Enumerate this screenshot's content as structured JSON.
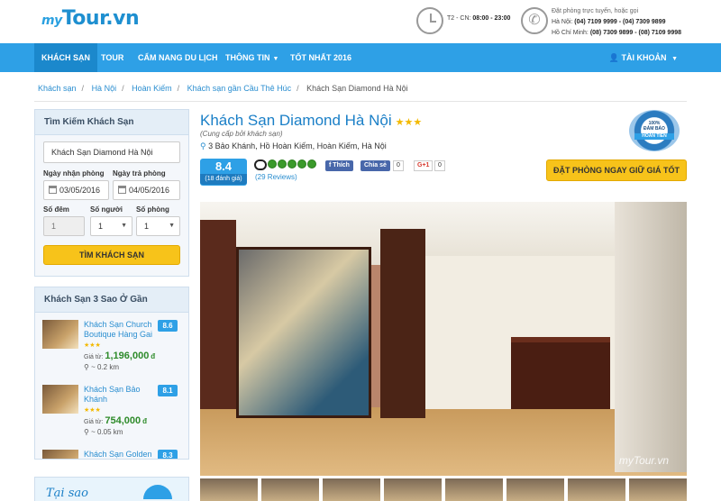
{
  "header": {
    "logo_prefix": "my",
    "logo_main": "Tour.vn",
    "hours_label": "T2 - CN:",
    "hours_value": "08:00 - 23:00",
    "contact_title": "Đặt phòng trực tuyến, hoặc gọi",
    "contact_hn_label": "Hà Nội:",
    "contact_hn_value": "(04) 7109 9999 - (04) 7309 9899",
    "contact_hcm_label": "Hồ Chí Minh:",
    "contact_hcm_value": "(08) 7309 9899 - (08) 7109 9998"
  },
  "nav": {
    "items": [
      "KHÁCH SẠN",
      "TOUR",
      "CẨM NANG DU LỊCH",
      "THÔNG TIN",
      "TỐT NHẤT 2016"
    ],
    "account": "TÀI KHOẢN"
  },
  "breadcrumb": [
    "Khách sạn",
    "Hà Nội",
    "Hoàn Kiếm",
    "Khách sạn gần Cầu Thê Húc",
    "Khách Sạn Diamond Hà Nội"
  ],
  "search": {
    "title": "Tìm Kiếm Khách Sạn",
    "hotel_value": "Khách Sạn Diamond Hà Nội",
    "checkin_label": "Ngày nhận phòng",
    "checkout_label": "Ngày trả phòng",
    "checkin_value": "03/05/2016",
    "checkout_value": "04/05/2016",
    "nights_label": "Số đêm",
    "people_label": "Số người",
    "rooms_label": "Số phòng",
    "nights_value": "1",
    "people_value": "1",
    "rooms_value": "1",
    "button": "TÌM KHÁCH SẠN"
  },
  "nearby": {
    "title": "Khách Sạn 3 Sao Ở Gần",
    "hotels": [
      {
        "name": "Khách Sạn Church Boutique Hàng Gai",
        "score": "8.6",
        "stars": "★★★",
        "price_from": "Giá từ:",
        "price": "1,196,000",
        "currency": "đ",
        "distance": "~ 0.2 km"
      },
      {
        "name": "Khách Sạn Bảo Khánh",
        "score": "8.1",
        "stars": "★★★",
        "price_from": "Giá từ:",
        "price": "754,000",
        "currency": "đ",
        "distance": "~ 0.05 km"
      },
      {
        "name": "Khách Sạn Golden",
        "score": "8.3"
      }
    ]
  },
  "promo": {
    "text": "Tại sao"
  },
  "hotel": {
    "name": "Khách Sạn Diamond Hà Nội",
    "stars": "★★★",
    "provided_by": "(Cung cấp bởi khách sạn)",
    "address": "3 Bảo Khánh, Hồ Hoàn Kiếm, Hoàn Kiếm, Hà Nội",
    "score": "8.4",
    "rating_count": "(18 đánh giá)",
    "reviews": "(29 Reviews)",
    "fb_like": "Thích",
    "fb_like_count": "0",
    "fb_share": "Chia sẻ",
    "fb_share_count": "0",
    "gplus": "G+1",
    "gplus_count": "0",
    "book_button": "ĐẶT PHÒNG NGAY GIỮ GIÁ TỐT",
    "badge_top": "100%",
    "badge_mid": "ĐẢM BẢO",
    "badge_ribbon": "HOÀN TIỀN",
    "watermark": "myTour.vn"
  },
  "colors": {
    "brand": "#2ea0e6",
    "nav_active": "#1b88cc",
    "button": "#f7c31a",
    "price": "#2e8b2a"
  }
}
